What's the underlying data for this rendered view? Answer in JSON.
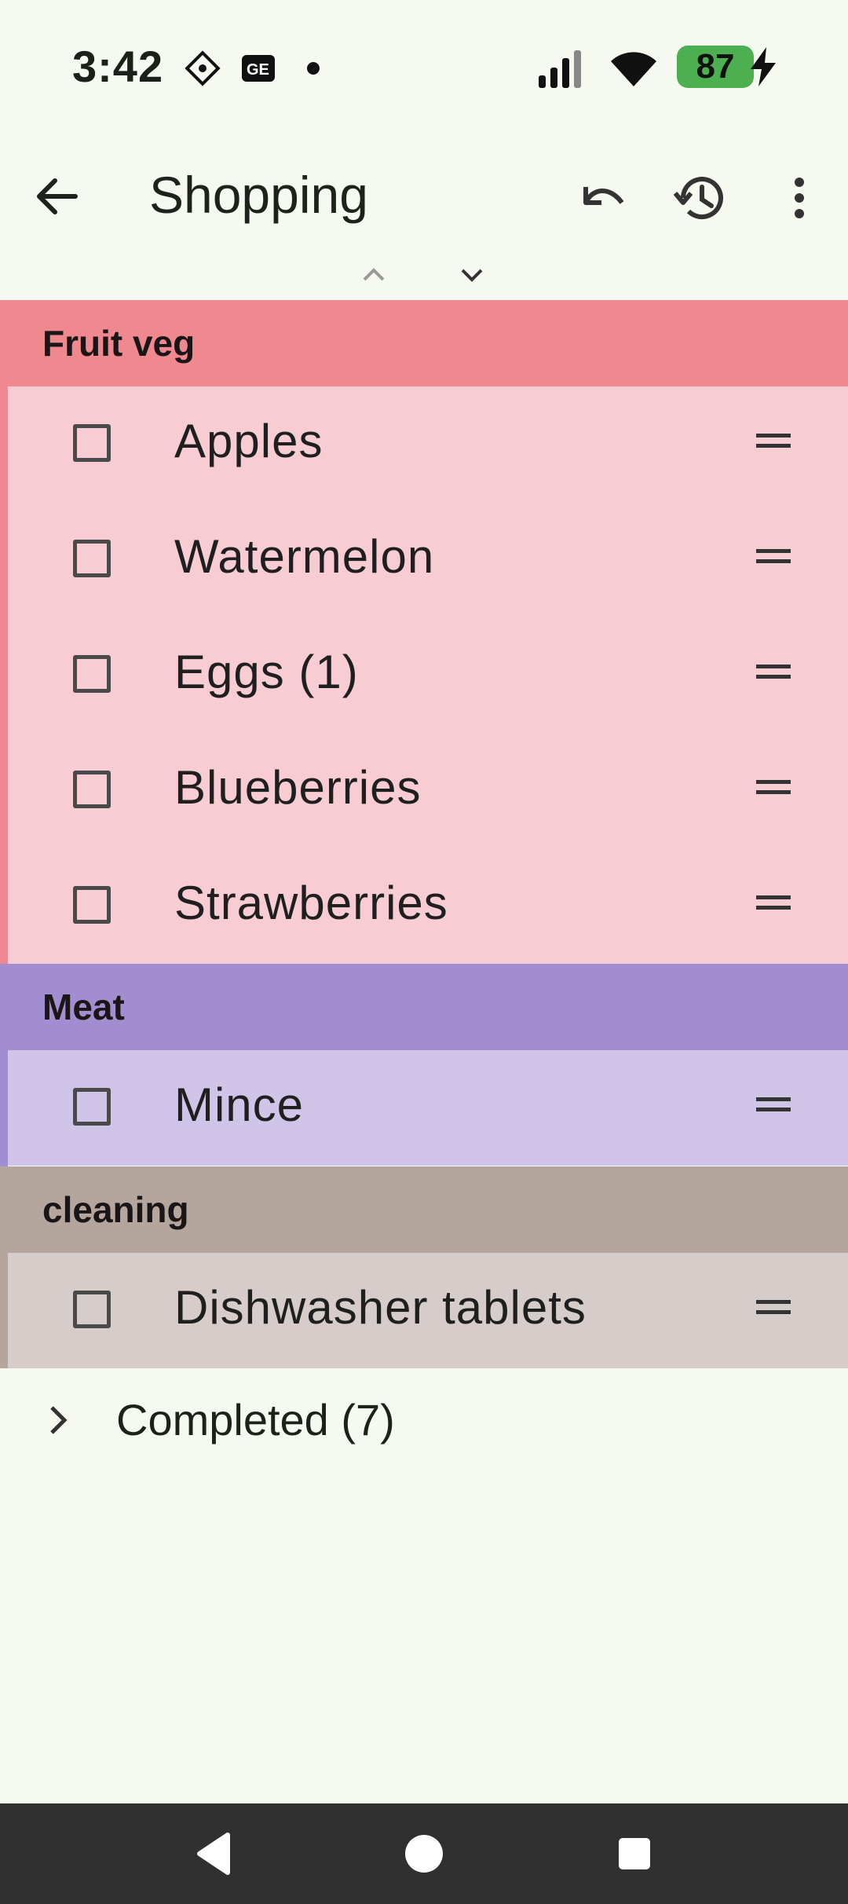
{
  "status_bar": {
    "time": "3:42",
    "battery": "87",
    "icons": [
      "sim-diamond-icon",
      "news-card-icon",
      "dot-icon",
      "signal-icon",
      "wifi-icon",
      "charging-bolt-icon"
    ]
  },
  "app_bar": {
    "title": "Shopping",
    "back_icon": "arrow-back-icon",
    "actions": [
      "undo-icon",
      "history-icon",
      "more-vert-icon"
    ]
  },
  "nav_arrows": [
    "chevron-up-icon",
    "chevron-down-icon"
  ],
  "categories": [
    {
      "name": "Fruit veg",
      "header_color": "#f0888f",
      "item_color": "#f7ccd2",
      "items": [
        "Apples",
        "Watermelon",
        "Eggs (1)",
        "Blueberries",
        "Strawberries"
      ]
    },
    {
      "name": "Meat",
      "header_color": "#a28dd0",
      "item_color": "#d0c4e8",
      "items": [
        "Mince"
      ]
    },
    {
      "name": "cleaning",
      "header_color": "#b4a59d",
      "item_color": "#d6ccc9",
      "items": [
        "Dishwasher tablets"
      ]
    }
  ],
  "completed": {
    "label": "Completed (7)"
  },
  "nav_bar": [
    "back-triangle-icon",
    "home-circle-icon",
    "recents-square-icon"
  ]
}
